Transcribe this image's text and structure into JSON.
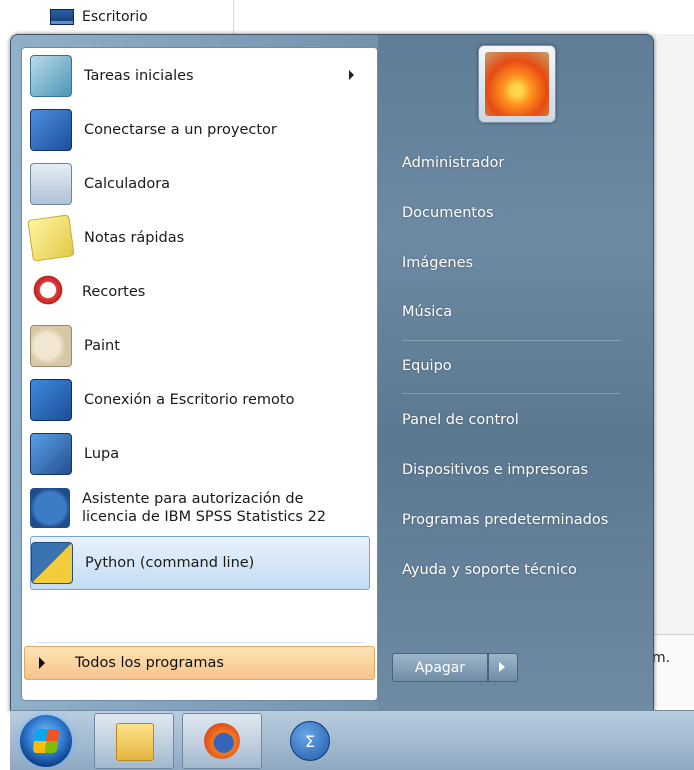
{
  "desktop": {
    "item_label": "Escritorio"
  },
  "background_window": {
    "fragment_text": "m."
  },
  "programs": [
    {
      "label": "Tareas iniciales",
      "icon": "getting-started-icon",
      "has_submenu": true
    },
    {
      "label": "Conectarse a un proyector",
      "icon": "projector-icon"
    },
    {
      "label": "Calculadora",
      "icon": "calculator-icon"
    },
    {
      "label": "Notas rápidas",
      "icon": "sticky-notes-icon"
    },
    {
      "label": "Recortes",
      "icon": "snipping-tool-icon"
    },
    {
      "label": "Paint",
      "icon": "paint-icon"
    },
    {
      "label": "Conexión a Escritorio remoto",
      "icon": "remote-desktop-icon"
    },
    {
      "label": "Lupa",
      "icon": "magnifier-icon"
    },
    {
      "label": "Asistente para autorización de licencia de IBM SPSS Statistics 22",
      "line1": "Asistente para autorización de",
      "line2": "licencia de IBM SPSS Statistics 22",
      "icon": "spss-license-icon"
    },
    {
      "label": "Python (command line)",
      "icon": "python-icon",
      "selected": true
    }
  ],
  "all_programs_label": "Todos los programas",
  "right_panel": {
    "items": [
      "Administrador",
      "Documentos",
      "Imágenes",
      "Música",
      "Equipo",
      "Panel de control",
      "Dispositivos e impresoras",
      "Programas predeterminados",
      "Ayuda y soporte técnico"
    ]
  },
  "shutdown": {
    "label": "Apagar"
  },
  "taskbar": {
    "pinned": [
      "windows-explorer-icon",
      "firefox-icon",
      "sigma-app-icon"
    ]
  }
}
